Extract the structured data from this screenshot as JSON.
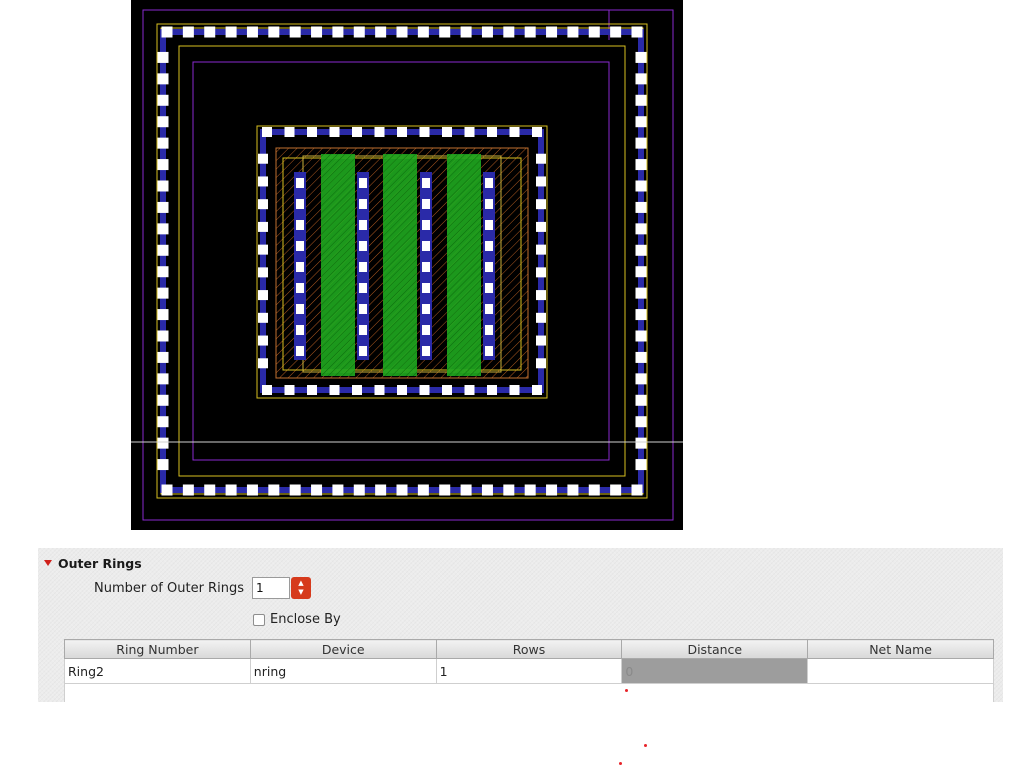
{
  "outer_rings": {
    "title": "Outer Rings",
    "num_label": "Number of Outer Rings",
    "num_value": "1",
    "enclose_by_label": "Enclose By",
    "enclose_by_checked": false,
    "columns": [
      "Ring Number",
      "Device",
      "Rows",
      "Distance",
      "Net Name"
    ],
    "rows": [
      {
        "ring_number": "Ring2",
        "device": "nring",
        "rows": "1",
        "distance": "0",
        "net_name": ""
      }
    ]
  },
  "colors": {
    "canvas_bg": "#000000",
    "contact": "#ffffff",
    "metal": "#2a2aa8",
    "poly_gate": "#1fa81f",
    "boundary_yellow": "#d8c020",
    "boundary_purple": "#8a2ad0",
    "accent_red": "#d63a1c"
  },
  "icons": {
    "collapse": "triangle-down-icon",
    "spinner": "spinner-arrows-icon"
  }
}
